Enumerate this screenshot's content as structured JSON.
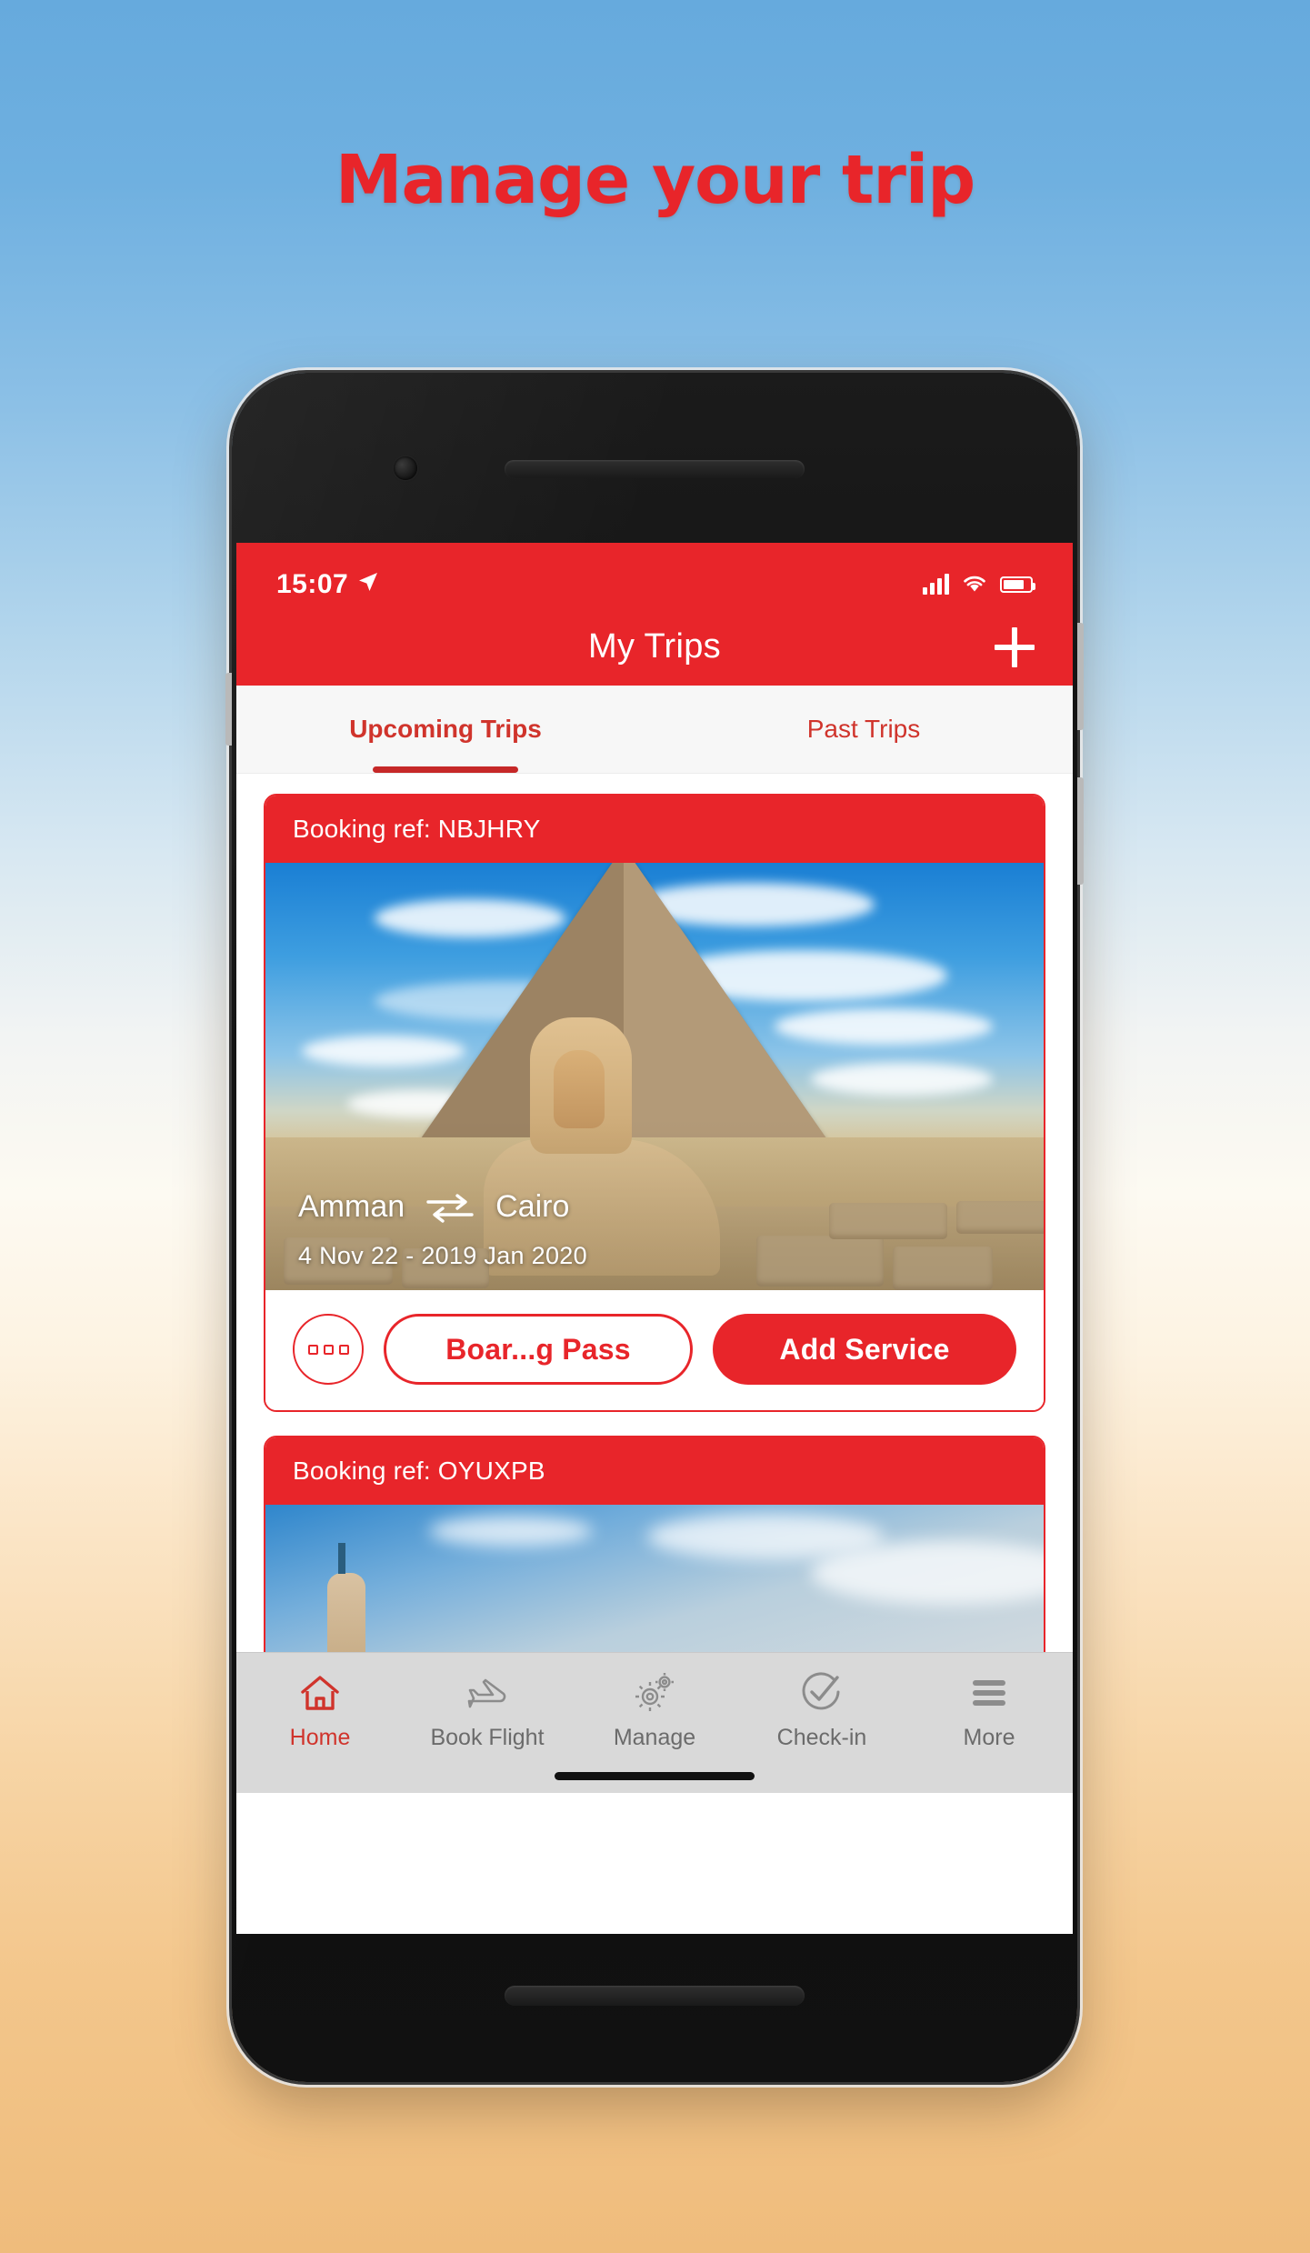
{
  "headline": "Manage your trip",
  "colors": {
    "brand_red": "#E8252A",
    "tab_red": "#D0342C",
    "nav_gray": "#d9d9d9",
    "sky_top": "#66aadd",
    "sand_bottom": "#efbc7c"
  },
  "status_bar": {
    "time": "15:07",
    "location_icon": "location-arrow-icon",
    "signal_icon": "cellular-signal-icon",
    "wifi_icon": "wifi-icon",
    "battery_icon": "battery-icon"
  },
  "app_bar": {
    "title": "My Trips",
    "add_icon": "plus-icon"
  },
  "tabs": [
    {
      "label": "Upcoming Trips",
      "active": true
    },
    {
      "label": "Past Trips",
      "active": false
    }
  ],
  "trips": [
    {
      "booking_ref_label": "Booking ref: NBJHRY",
      "origin": "Amman",
      "destination": "Cairo",
      "swap_icon": "two-way-arrows-icon",
      "dates": "4 Nov 22 - 2019 Jan 2020",
      "image_alt": "great-sphinx-and-pyramid-of-giza",
      "actions": {
        "more_icon": "three-dots-icon",
        "boarding_pass_label": "Boar...g Pass",
        "add_service_label": "Add Service"
      }
    },
    {
      "booking_ref_label": "Booking ref: OYUXPB",
      "image_alt": "minaret-against-blue-sky"
    }
  ],
  "bottom_nav": [
    {
      "label": "Home",
      "icon": "home-icon",
      "active": true
    },
    {
      "label": "Book Flight",
      "icon": "airplane-icon",
      "active": false
    },
    {
      "label": "Manage",
      "icon": "gears-icon",
      "active": false
    },
    {
      "label": "Check-in",
      "icon": "check-circle-icon",
      "active": false
    },
    {
      "label": "More",
      "icon": "hamburger-menu-icon",
      "active": false
    }
  ]
}
